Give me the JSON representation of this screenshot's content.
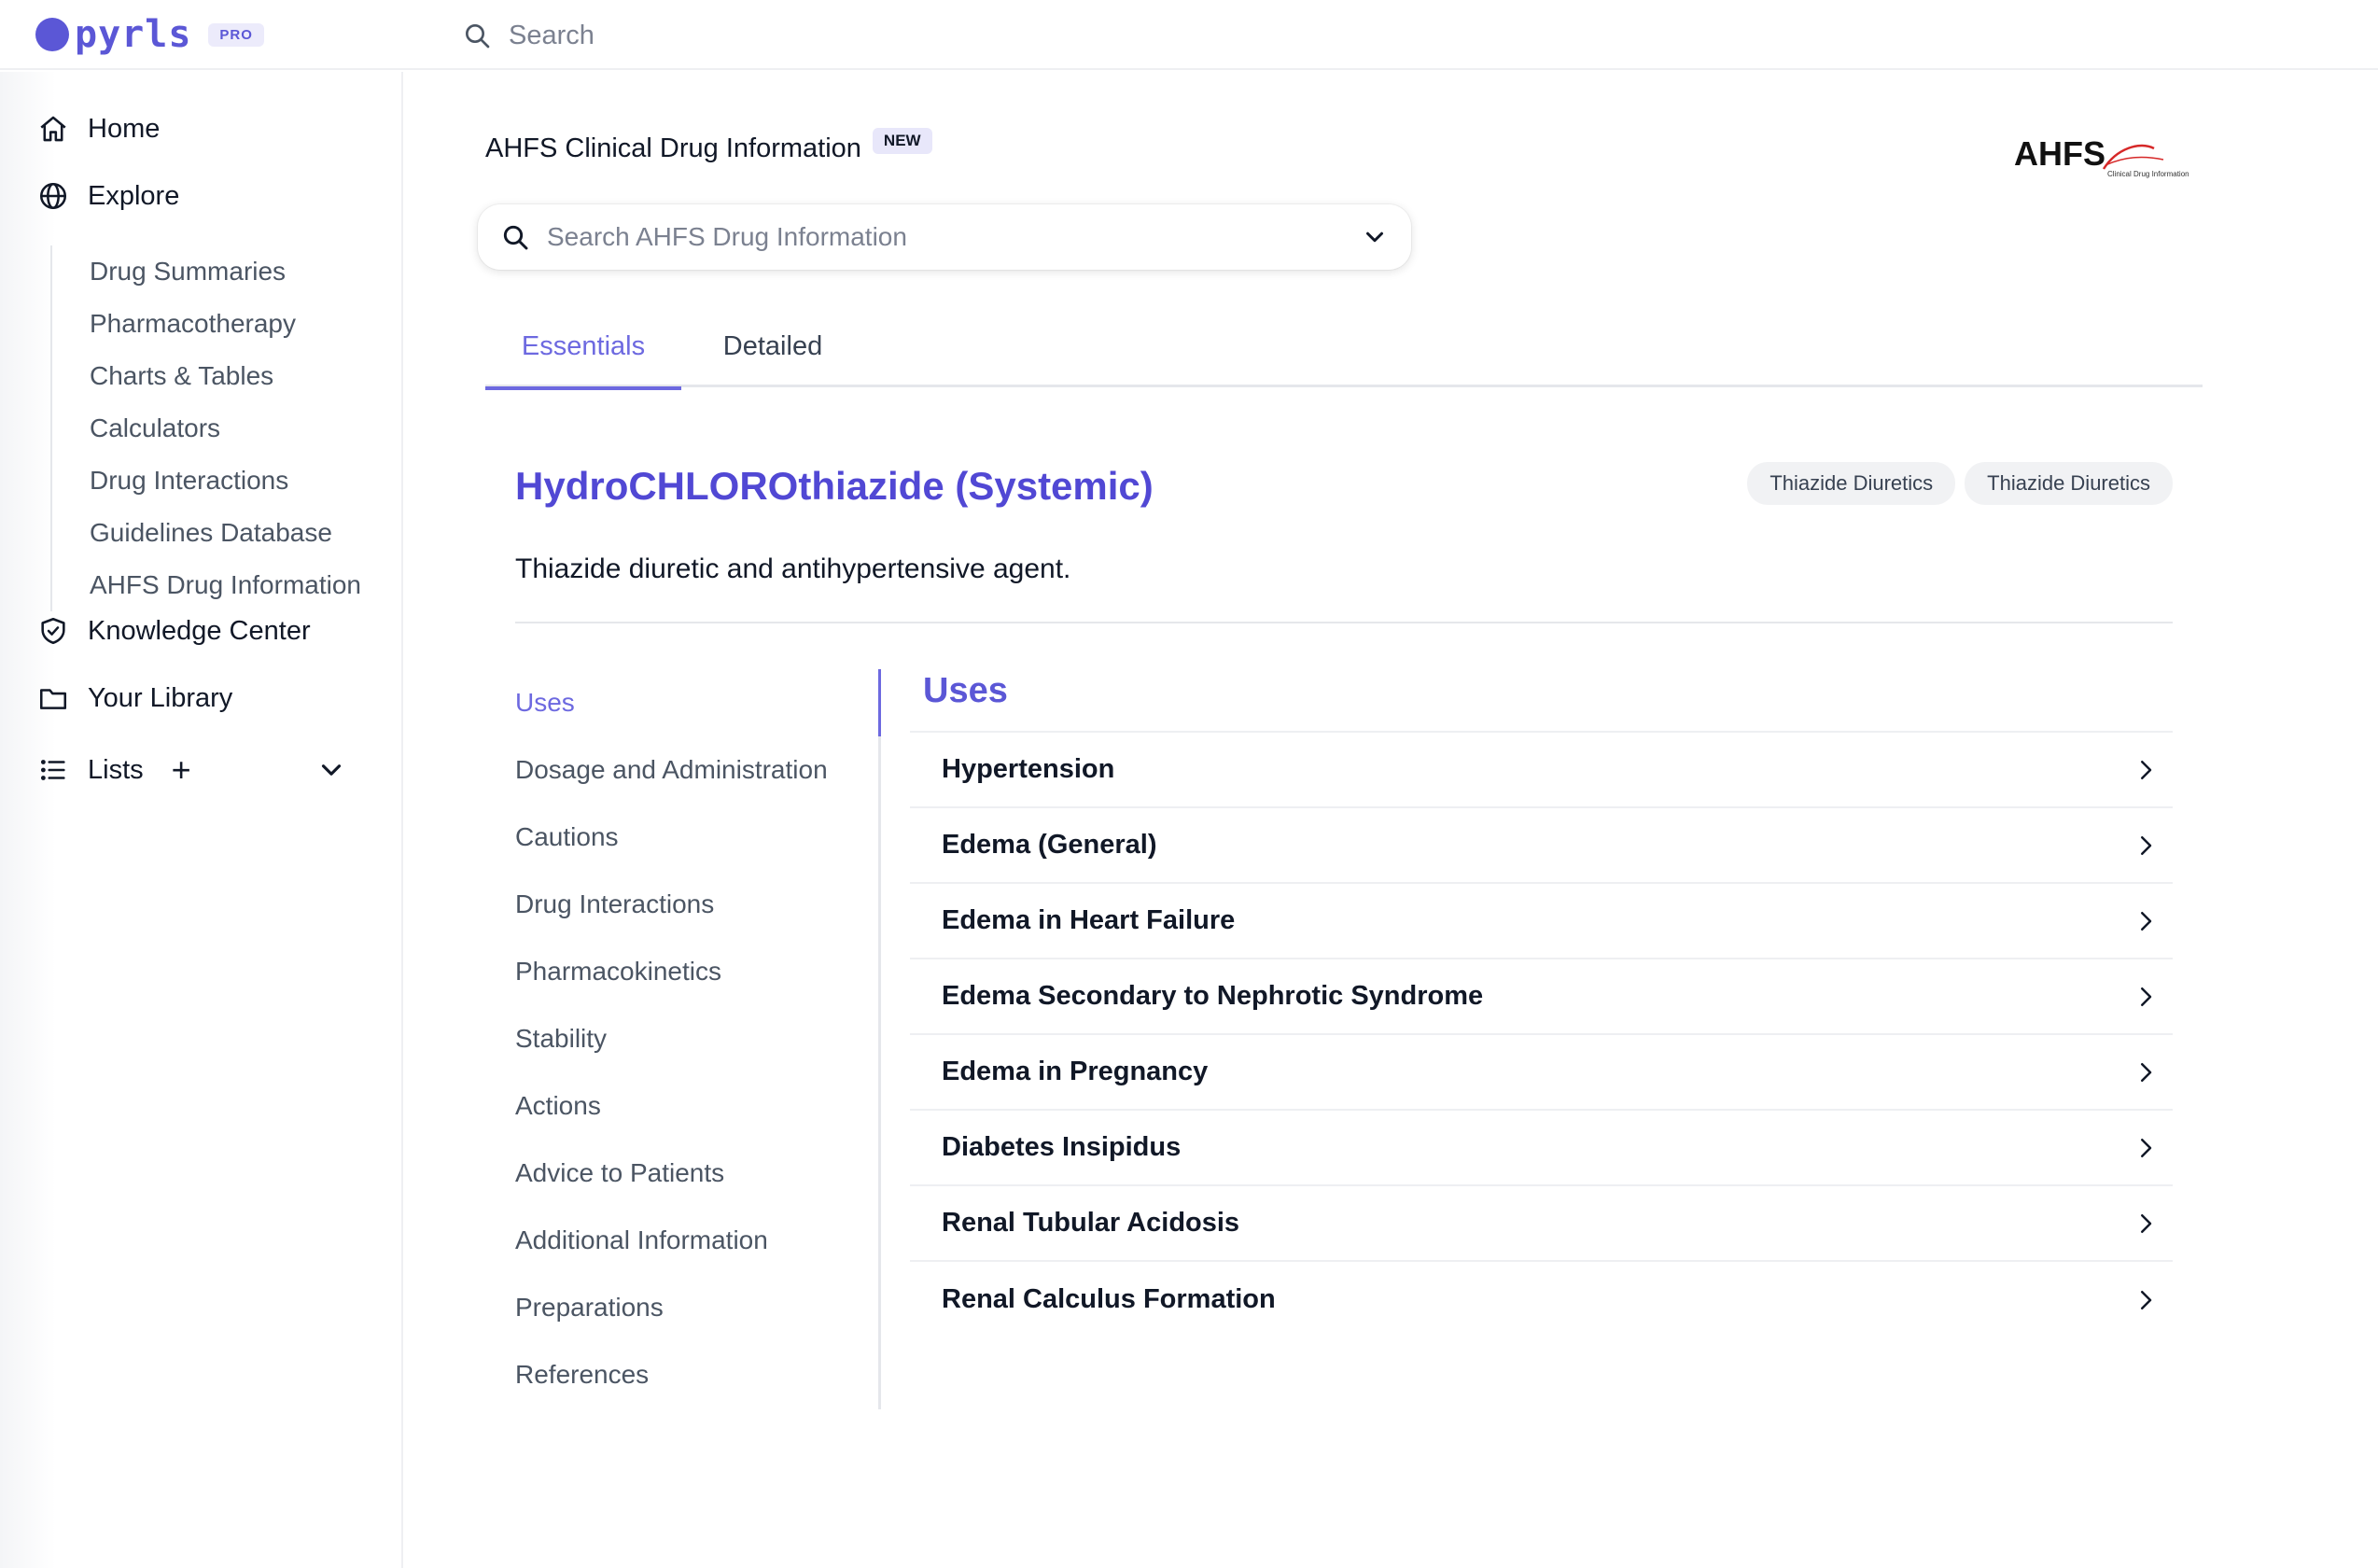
{
  "app": {
    "name": "pyrls",
    "badge": "PRO"
  },
  "topbar": {
    "search_placeholder": "Search"
  },
  "sidebar": {
    "home": "Home",
    "explore": "Explore",
    "explore_items": [
      "Drug Summaries",
      "Pharmacotherapy",
      "Charts & Tables",
      "Calculators",
      "Drug Interactions",
      "Guidelines Database",
      "AHFS Drug Information"
    ],
    "knowledge_center": "Knowledge Center",
    "your_library": "Your Library",
    "lists": "Lists",
    "lists_add": "+"
  },
  "header": {
    "title": "AHFS Clinical Drug Information",
    "badge": "NEW",
    "logo_text": "AHFS",
    "logo_subtext": "Clinical Drug Information",
    "search_placeholder": "Search AHFS Drug Information"
  },
  "tabs": [
    {
      "label": "Essentials",
      "active": true
    },
    {
      "label": "Detailed",
      "active": false
    }
  ],
  "monograph": {
    "title": "HydroCHLOROthiazide (Systemic)",
    "classes": [
      "Thiazide Diuretics",
      "Thiazide Diuretics"
    ],
    "description": "Thiazide diuretic and antihypertensive agent."
  },
  "sections": [
    "Uses",
    "Dosage and Administration",
    "Cautions",
    "Drug Interactions",
    "Pharmacokinetics",
    "Stability",
    "Actions",
    "Advice to Patients",
    "Additional Information",
    "Preparations",
    "References"
  ],
  "active_section": "Uses",
  "uses": {
    "heading": "Uses",
    "items": [
      "Hypertension",
      "Edema (General)",
      "Edema in Heart Failure",
      "Edema Secondary to Nephrotic Syndrome",
      "Edema in Pregnancy",
      "Diabetes Insipidus",
      "Renal Tubular Acidosis",
      "Renal Calculus Formation"
    ]
  },
  "colors": {
    "brand": "#5b57d6",
    "accent": "#6d69e0",
    "title": "#5148d4"
  }
}
